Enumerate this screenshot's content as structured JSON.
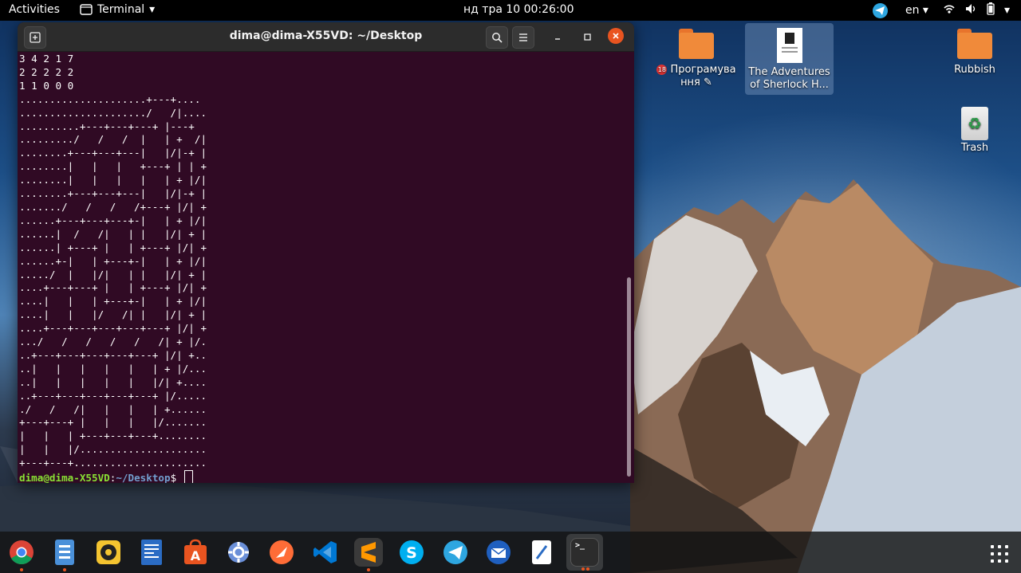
{
  "topbar": {
    "activities": "Activities",
    "app_name": "Terminal",
    "clock": "нд тра 10  00:26:00",
    "language": "en"
  },
  "desktop": {
    "icons": [
      {
        "label": "Програмува ння ✎",
        "badge": "18"
      },
      {
        "label": "The Adventures of Sherlock H..."
      },
      {
        "label": "Rubbish"
      },
      {
        "label": "Trash"
      }
    ]
  },
  "terminal": {
    "title": "dima@dima-X55VD: ~/Desktop",
    "output": "3 4 2 1 7\n2 2 2 2 2\n1 1 0 0 0\n.....................+---+....\n...................../   /|....\n..........+---+---+---+ |---+\n........./   /   /  |   | +  /|\n........+---+---+---|   |/|-+ |\n........|   |   |   +---+ | | +\n........|   |   |   |   | + |/|\n........+---+---+---|   |/|-+ |\n......./   /   /   /+---+ |/| +\n......+---+---+---+-|   | + |/|\n......|  /   /|   | |   |/| + |\n......| +---+ |   | +---+ |/| +\n......+-|   | +---+-|   | + |/|\n...../  |   |/|   | |   |/| + |\n....+---+---+ |   | +---+ |/| +\n....|   |   | +---+-|   | + |/|\n....|   |   |/   /| |   |/| + |\n....+---+---+---+---+---+ |/| +\n.../   /   /   /   /   /| + |/.\n..+---+---+---+---+---+ |/| +..\n..|   |   |   |   |   | + |/...\n..|   |   |   |   |   |/| +....\n..+---+---+---+---+---+ |/.....\n./   /   /|   |   |   | +......\n+---+---+ |   |   |   |/.......\n|   |   | +---+---+---+........\n|   |   |/.....................\n+---+---+......................",
    "prompt_user": "dima@dima-X55VD",
    "prompt_sep": ":",
    "prompt_path": "~/Desktop",
    "prompt_symbol": "$ "
  },
  "dock": {
    "apps": [
      {
        "name": "chrome",
        "color": "#4285f4"
      },
      {
        "name": "files",
        "color": "#4a90d9"
      },
      {
        "name": "rhythmbox",
        "color": "#f4c430"
      },
      {
        "name": "docs",
        "color": "#2b6cc4"
      },
      {
        "name": "software",
        "color": "#e95420"
      },
      {
        "name": "settings",
        "color": "#6a8fd8"
      },
      {
        "name": "postman",
        "color": "#ff6c37"
      },
      {
        "name": "vscode",
        "color": "#0078d4"
      },
      {
        "name": "sublime",
        "color": "#ff9800"
      },
      {
        "name": "skype",
        "color": "#00aff0"
      },
      {
        "name": "telegram",
        "color": "#2ea6e0"
      },
      {
        "name": "thunderbird",
        "color": "#1f5fbf"
      },
      {
        "name": "text-editor",
        "color": "#ffffff"
      },
      {
        "name": "terminal",
        "color": "#2c2c2c"
      }
    ],
    "terminal_glyph": ">_"
  }
}
